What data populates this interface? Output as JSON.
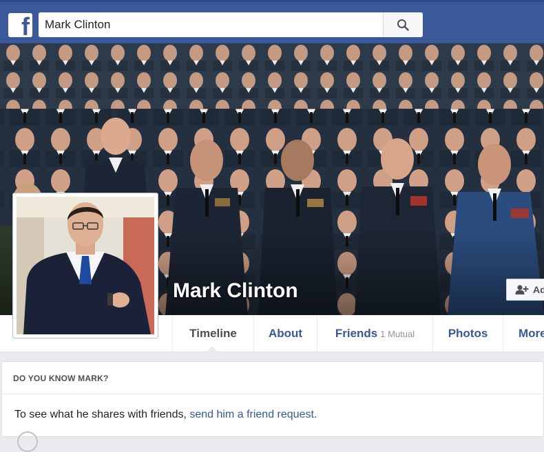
{
  "header": {
    "logo": "f",
    "search_value": "Mark Clinton",
    "search_icon": "search-icon"
  },
  "cover": {
    "name": "Mark Clinton",
    "add_friend_label": "Ad",
    "add_friend_icon": "add-friend-icon"
  },
  "nav": {
    "tabs": [
      {
        "label": "Timeline",
        "active": true
      },
      {
        "label": "About"
      },
      {
        "label": "Friends",
        "sub": "1 Mutual"
      },
      {
        "label": "Photos"
      },
      {
        "label": "More"
      }
    ]
  },
  "know": {
    "title": "DO YOU KNOW MARK?",
    "text": "To see what he shares with friends, ",
    "link": "send him a friend request."
  },
  "colors": {
    "brand": "#3b5998",
    "link": "#365899",
    "background": "#e9ebee"
  }
}
